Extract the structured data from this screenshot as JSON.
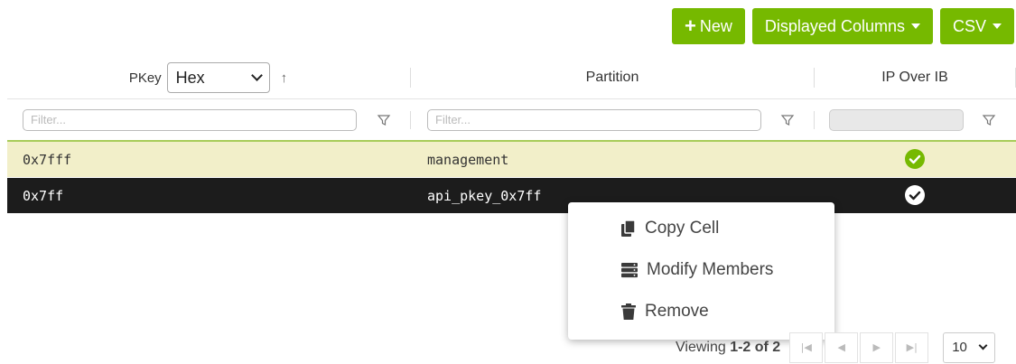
{
  "toolbar": {
    "new_label": "New",
    "columns_label": "Displayed Columns",
    "csv_label": "CSV",
    "button_color": "#76b900"
  },
  "columns": {
    "pkey": "PKey",
    "pkey_format": "Hex",
    "partition": "Partition",
    "ip_over_ib": "IP Over IB"
  },
  "filters": {
    "pkey_placeholder": "Filter...",
    "partition_placeholder": "Filter..."
  },
  "rows": [
    {
      "pkey": "0x7fff",
      "partition": "management",
      "ip_over_ib": true
    },
    {
      "pkey": "0x7ff",
      "partition": "api_pkey_0x7ff",
      "ip_over_ib": true
    }
  ],
  "context_menu": {
    "items": [
      {
        "label": "Copy Cell",
        "icon": "copy-icon"
      },
      {
        "label": "Modify Members",
        "icon": "server-icon"
      },
      {
        "label": "Remove",
        "icon": "trash-icon"
      }
    ]
  },
  "pagination": {
    "viewing_prefix": "Viewing ",
    "viewing_range": "1-2 of 2",
    "page_size": "10"
  }
}
